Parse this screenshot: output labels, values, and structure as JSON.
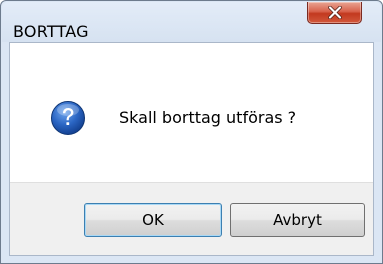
{
  "window": {
    "title": "BORTTAG",
    "close_icon": "close-x-icon"
  },
  "message": {
    "icon": "question-icon",
    "text": "Skall borttag utföras ?"
  },
  "buttons": {
    "ok_label": "OK",
    "cancel_label": "Avbryt"
  },
  "colors": {
    "close_button": "#c2391f",
    "question_icon": "#1b56b3",
    "default_button_border": "#3c7fb1"
  }
}
